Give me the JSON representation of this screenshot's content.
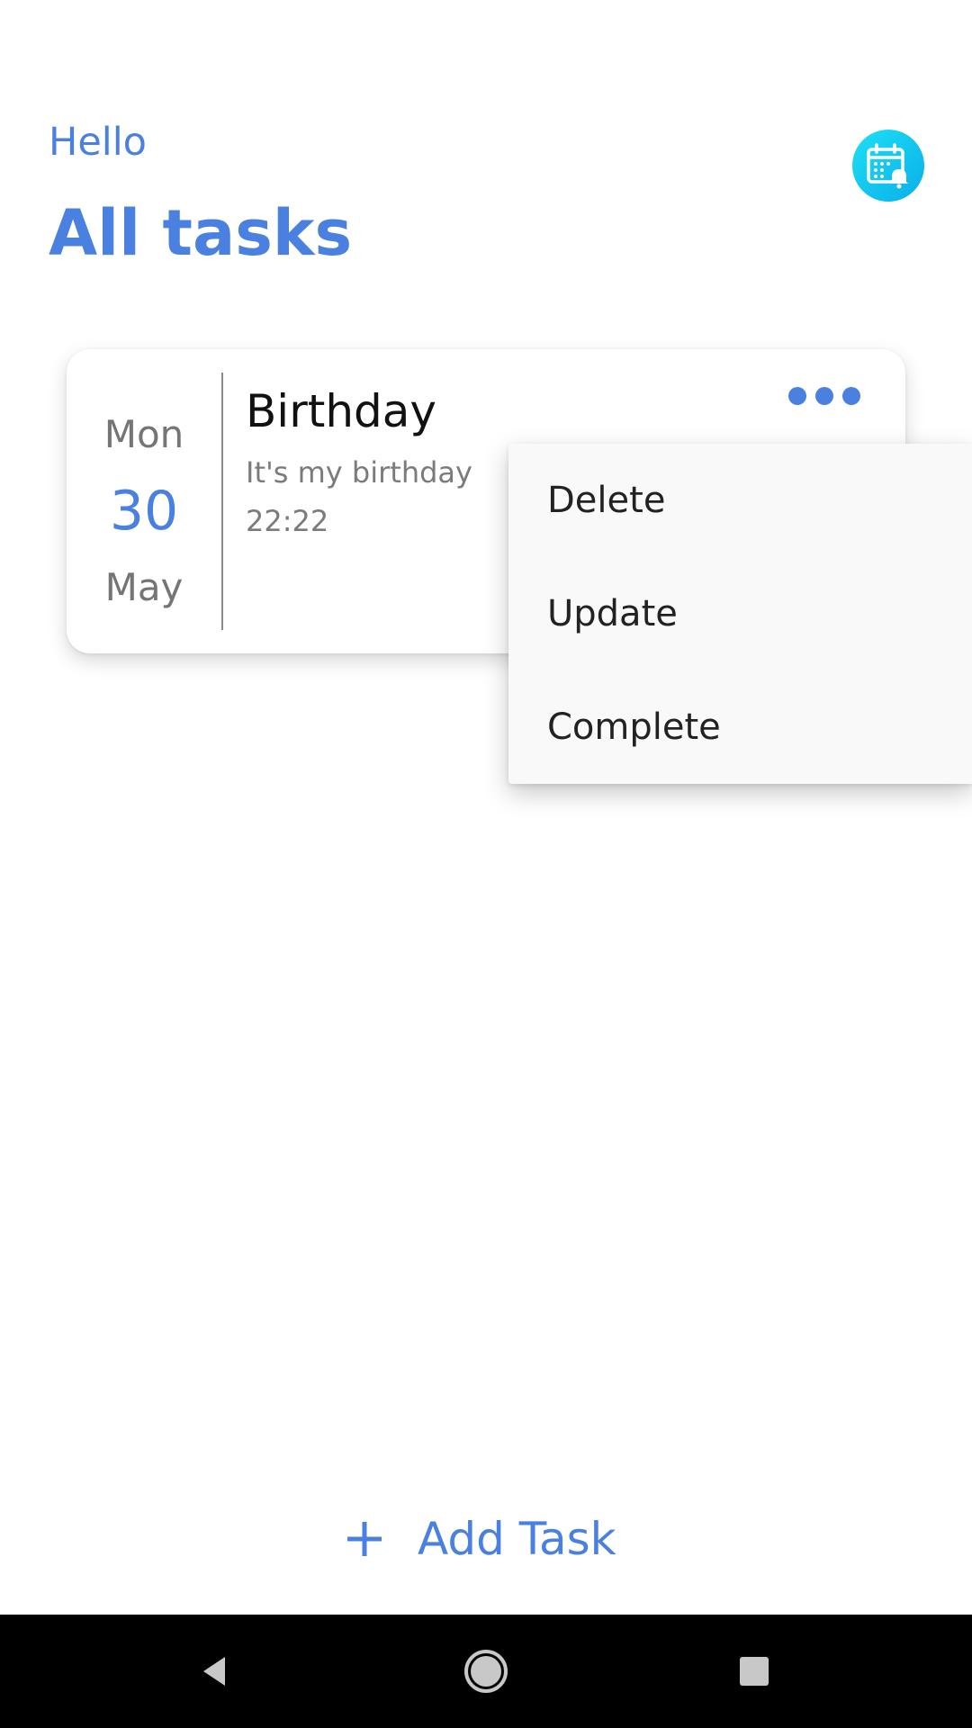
{
  "header": {
    "greeting": "Hello",
    "title": "All tasks",
    "reminder_icon": "calendar-bell-icon"
  },
  "colors": {
    "accent": "#4a80e0",
    "reminder_button": "#0ab8ec",
    "menu_background": "#f9f9f9",
    "nav_bar": "#000000"
  },
  "task": {
    "day_of_week": "Mon",
    "day": "30",
    "month": "May",
    "title": "Birthday",
    "description": "It's my birthday",
    "time": "22:22",
    "more_icon": "more-horizontal-icon"
  },
  "menu": {
    "items": [
      {
        "label": "Delete"
      },
      {
        "label": "Update"
      },
      {
        "label": "Complete"
      }
    ]
  },
  "footer": {
    "add_icon": "plus-icon",
    "add_label": "Add Task"
  },
  "navigation": {
    "back_icon": "back-icon",
    "home_icon": "home-icon",
    "recents_icon": "recents-icon"
  }
}
